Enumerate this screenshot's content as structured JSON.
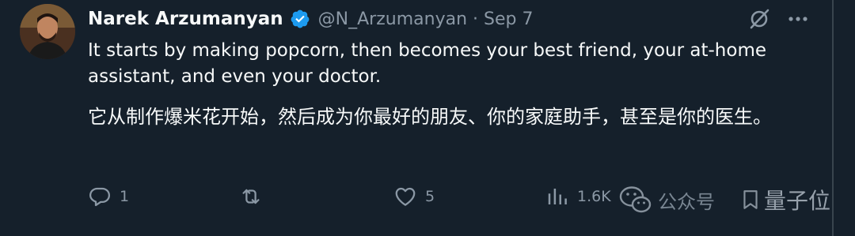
{
  "author": {
    "name": "Narek Arzumanyan",
    "handle": "@N_Arzumanyan",
    "separator": "·",
    "date": "Sep 7",
    "avatar_icon": "profile-photo",
    "verified_icon": "verified-badge-icon"
  },
  "header_actions": {
    "grok_icon": "grok-icon",
    "more_icon": "more-icon"
  },
  "tweet": {
    "text_en": "It starts by making popcorn, then becomes your best friend, your at-home assistant, and even your doctor.",
    "text_zh": "它从制作爆米花开始，然后成为你最好的朋友、你的家庭助手，甚至是你的医生。"
  },
  "actions": {
    "reply_count": "1",
    "retweet_count": "",
    "like_count": "5",
    "views_count": "1.6K"
  },
  "watermark": {
    "wechat_label": "公众号",
    "brand": "量子位"
  },
  "colors": {
    "background": "#15202b",
    "text": "#f7f9f9",
    "secondary": "#8b98a5",
    "verified": "#1d9bf0"
  }
}
